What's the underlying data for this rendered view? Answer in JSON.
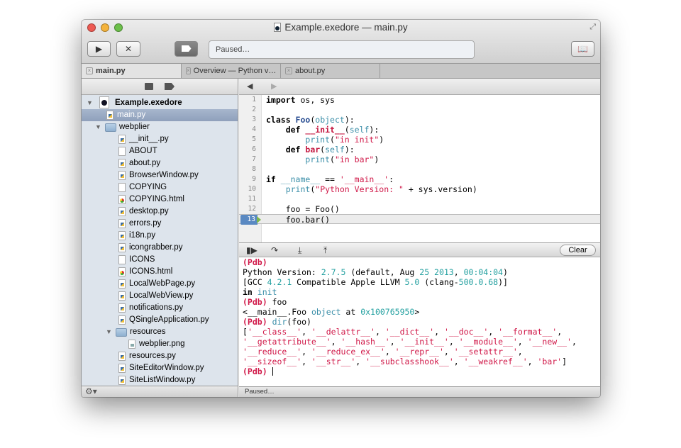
{
  "window": {
    "title": "Example.exedore — main.py"
  },
  "toolbar": {
    "run_icon": "play-icon",
    "stop_icon": "x-icon",
    "tag_icon": "tag-icon",
    "status": "Paused…",
    "book_icon": "book-icon"
  },
  "tabs": [
    {
      "label": "main.py",
      "active": true
    },
    {
      "label": "Overview — Python v…"
    },
    {
      "label": "about.py"
    }
  ],
  "sidebar": {
    "project": "Example.exedore",
    "items": [
      {
        "label": "main.py",
        "type": "py",
        "depth": 1,
        "selected": true
      },
      {
        "label": "webplier",
        "type": "folder",
        "depth": 1
      },
      {
        "label": "__init__.py",
        "type": "py",
        "depth": 2
      },
      {
        "label": "ABOUT",
        "type": "file",
        "depth": 2
      },
      {
        "label": "about.py",
        "type": "py",
        "depth": 2
      },
      {
        "label": "BrowserWindow.py",
        "type": "py",
        "depth": 2
      },
      {
        "label": "COPYING",
        "type": "file",
        "depth": 2
      },
      {
        "label": "COPYING.html",
        "type": "html",
        "depth": 2
      },
      {
        "label": "desktop.py",
        "type": "py",
        "depth": 2
      },
      {
        "label": "errors.py",
        "type": "py",
        "depth": 2
      },
      {
        "label": "i18n.py",
        "type": "py",
        "depth": 2
      },
      {
        "label": "icongrabber.py",
        "type": "py",
        "depth": 2
      },
      {
        "label": "ICONS",
        "type": "file",
        "depth": 2
      },
      {
        "label": "ICONS.html",
        "type": "html",
        "depth": 2
      },
      {
        "label": "LocalWebPage.py",
        "type": "py",
        "depth": 2
      },
      {
        "label": "LocalWebView.py",
        "type": "py",
        "depth": 2
      },
      {
        "label": "notifications.py",
        "type": "py",
        "depth": 2
      },
      {
        "label": "QSingleApplication.py",
        "type": "py",
        "depth": 2
      },
      {
        "label": "resources",
        "type": "folder",
        "depth": 2
      },
      {
        "label": "webplier.png",
        "type": "png",
        "depth": 3
      },
      {
        "label": "resources.py",
        "type": "py",
        "depth": 2
      },
      {
        "label": "SiteEditorWindow.py",
        "type": "py",
        "depth": 2
      },
      {
        "label": "SiteListWindow.py",
        "type": "py",
        "depth": 2
      }
    ],
    "gear_icon": "gear-icon"
  },
  "editor": {
    "current_line": 13,
    "lines": [
      [
        [
          "import",
          "kw"
        ],
        [
          " os, sys",
          "pl"
        ]
      ],
      [],
      [
        [
          "class ",
          "kw"
        ],
        [
          "Foo",
          "cls"
        ],
        [
          "(",
          "pl"
        ],
        [
          "object",
          "bi"
        ],
        [
          "):",
          "pl"
        ]
      ],
      [
        [
          "    def ",
          "kw"
        ],
        [
          "__init__",
          "fn"
        ],
        [
          "(",
          "pl"
        ],
        [
          "self",
          "bi"
        ],
        [
          "):",
          "pl"
        ]
      ],
      [
        [
          "        ",
          "pl"
        ],
        [
          "print",
          "bi"
        ],
        [
          "(",
          "pl"
        ],
        [
          "\"in init\"",
          "str"
        ],
        [
          ")",
          "pl"
        ]
      ],
      [
        [
          "    def ",
          "kw"
        ],
        [
          "bar",
          "fn"
        ],
        [
          "(",
          "pl"
        ],
        [
          "self",
          "bi"
        ],
        [
          "):",
          "pl"
        ]
      ],
      [
        [
          "        ",
          "pl"
        ],
        [
          "print",
          "bi"
        ],
        [
          "(",
          "pl"
        ],
        [
          "\"in bar\"",
          "str"
        ],
        [
          ")",
          "pl"
        ]
      ],
      [],
      [
        [
          "if ",
          "kw"
        ],
        [
          "__name__",
          "bi"
        ],
        [
          " == ",
          "pl"
        ],
        [
          "'__main__'",
          "str"
        ],
        [
          ":",
          "pl"
        ]
      ],
      [
        [
          "    ",
          "pl"
        ],
        [
          "print",
          "bi"
        ],
        [
          "(",
          "pl"
        ],
        [
          "\"Python Version: \"",
          "str"
        ],
        [
          " + sys.version)",
          "pl"
        ]
      ],
      [],
      [
        [
          "    foo = Foo()",
          "pl"
        ]
      ],
      [
        [
          "    foo.bar()",
          "pl"
        ]
      ]
    ]
  },
  "debugger": {
    "clear_label": "Clear",
    "console": [
      [
        [
          "(Pdb)",
          "pdb"
        ]
      ],
      [
        [
          "Python Version: ",
          "pl"
        ],
        [
          "2.7.5",
          "num"
        ],
        [
          " (default, Aug ",
          "pl"
        ],
        [
          "25 2013",
          "num"
        ],
        [
          ", ",
          "pl"
        ],
        [
          "00:04:04",
          "num"
        ],
        [
          ")",
          "pl"
        ]
      ],
      [
        [
          "[GCC ",
          "pl"
        ],
        [
          "4.2.1",
          "num"
        ],
        [
          " Compatible Apple LLVM ",
          "pl"
        ],
        [
          "5.0",
          "num"
        ],
        [
          " (clang-",
          "pl"
        ],
        [
          "500.0.68",
          "num"
        ],
        [
          ")]",
          "pl"
        ]
      ],
      [
        [
          "in ",
          "kw"
        ],
        [
          "init",
          "bi"
        ]
      ],
      [
        [
          "(Pdb)",
          "pdb"
        ],
        [
          " foo",
          "pl"
        ]
      ],
      [
        [
          "<__main__.Foo ",
          "pl"
        ],
        [
          "object",
          "bi"
        ],
        [
          " at ",
          "pl"
        ],
        [
          "0x100765950",
          "num"
        ],
        [
          ">",
          "pl"
        ]
      ],
      [
        [
          "(Pdb)",
          "pdb"
        ],
        [
          " ",
          "pl"
        ],
        [
          "dir",
          "bi"
        ],
        [
          "(foo)",
          "pl"
        ]
      ],
      [
        [
          "[",
          "pl"
        ],
        [
          "'__class__'",
          "str"
        ],
        [
          ", ",
          "pl"
        ],
        [
          "'__delattr__'",
          "str"
        ],
        [
          ", ",
          "pl"
        ],
        [
          "'__dict__'",
          "str"
        ],
        [
          ", ",
          "pl"
        ],
        [
          "'__doc__'",
          "str"
        ],
        [
          ", ",
          "pl"
        ],
        [
          "'__format__'",
          "str"
        ],
        [
          ",",
          "pl"
        ]
      ],
      [
        [
          "'__getattribute__'",
          "str"
        ],
        [
          ", ",
          "pl"
        ],
        [
          "'__hash__'",
          "str"
        ],
        [
          ", ",
          "pl"
        ],
        [
          "'__init__'",
          "str"
        ],
        [
          ", ",
          "pl"
        ],
        [
          "'__module__'",
          "str"
        ],
        [
          ", ",
          "pl"
        ],
        [
          "'__new__'",
          "str"
        ],
        [
          ",",
          "pl"
        ]
      ],
      [
        [
          "'__reduce__'",
          "str"
        ],
        [
          ", ",
          "pl"
        ],
        [
          "'__reduce_ex__'",
          "str"
        ],
        [
          ", ",
          "pl"
        ],
        [
          "'__repr__'",
          "str"
        ],
        [
          ", ",
          "pl"
        ],
        [
          "'__setattr__'",
          "str"
        ],
        [
          ",",
          "pl"
        ]
      ],
      [
        [
          "'__sizeof__'",
          "str"
        ],
        [
          ", ",
          "pl"
        ],
        [
          "'__str__'",
          "str"
        ],
        [
          ", ",
          "pl"
        ],
        [
          "'__subclasshook__'",
          "str"
        ],
        [
          ", ",
          "pl"
        ],
        [
          "'__weakref__'",
          "str"
        ],
        [
          ", ",
          "pl"
        ],
        [
          "'bar'",
          "str"
        ],
        [
          "]",
          "pl"
        ]
      ],
      [
        [
          "(Pdb)",
          "pdb"
        ],
        [
          " ",
          "pl"
        ]
      ]
    ]
  },
  "statusbar": {
    "text": "Paused…"
  }
}
